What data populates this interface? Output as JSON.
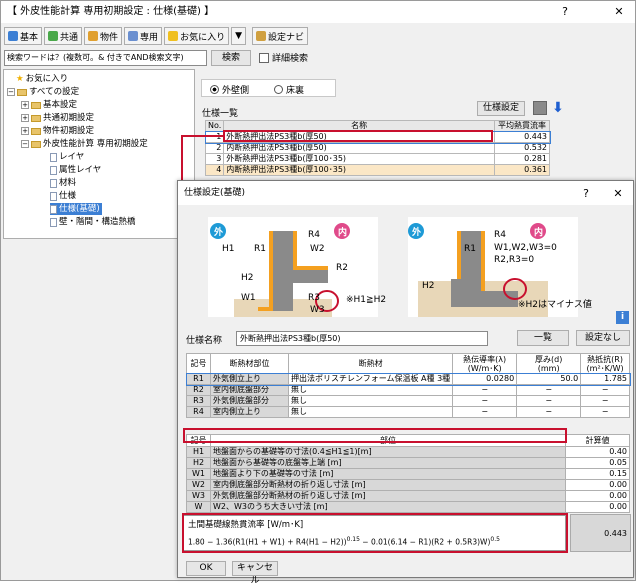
{
  "window": {
    "title": "【 外皮性能計算 専用初期設定 : 仕様(基礎) 】",
    "help": "?",
    "close": "✕"
  },
  "toolbar": {
    "basic": "基本",
    "common": "共通",
    "property": "物件",
    "dedicated": "専用",
    "favorites": "お気に入り",
    "dropdown": "▼",
    "navi": "設定ナビ"
  },
  "search": {
    "value": "検索ワードは？(複数可。& 付きでAND検索文字)",
    "button": "検索",
    "detail": "詳細検索"
  },
  "tree": [
    {
      "label": "お気に入り",
      "level": 0,
      "icon": "star"
    },
    {
      "label": "すべての設定",
      "level": 0,
      "expander": "−"
    },
    {
      "label": "基本設定",
      "level": 1,
      "expander": "+"
    },
    {
      "label": "共通初期設定",
      "level": 1,
      "expander": "+"
    },
    {
      "label": "物件初期設定",
      "level": 1,
      "expander": "+"
    },
    {
      "label": "外皮性能計算 専用初期設定",
      "level": 1,
      "expander": "−"
    },
    {
      "label": "レイヤ",
      "level": 2
    },
    {
      "label": "属性レイヤ",
      "level": 2
    },
    {
      "label": "材料",
      "level": 2
    },
    {
      "label": "仕様",
      "level": 2
    },
    {
      "label": "仕様(基礎)",
      "level": 2,
      "selected": true
    },
    {
      "label": "壁・階間・構造熱橋",
      "level": 2
    }
  ],
  "side": {
    "radio_outer": "外壁側",
    "radio_floor": "床裏",
    "list_title": "仕様一覧",
    "spec_button": "仕様設定"
  },
  "spec_list": {
    "headers": [
      "No.",
      "名称",
      "平均熱貫流率"
    ],
    "rows": [
      [
        "1",
        "外断熱押出法PS3種b(厚50)",
        "0.443"
      ],
      [
        "2",
        "内断熱押出法PS3種b(厚50)",
        "0.532"
      ],
      [
        "3",
        "外断熱押出法PS3種b(厚100･35)",
        "0.281"
      ],
      [
        "4",
        "内断熱押出法PS3種b(厚100･35)",
        "0.361"
      ]
    ]
  },
  "dialog": {
    "title": "仕様設定(基礎)",
    "help": "?",
    "close": "✕",
    "outer": "外",
    "inner": "内",
    "d1": {
      "H1": "H1",
      "R1": "R1",
      "R4": "R4",
      "W2": "W2",
      "R2": "R2",
      "H2": "H2",
      "W1": "W1",
      "R3": "R3",
      "W3": "W3",
      "note": "※H1≧H2"
    },
    "d2": {
      "R1": "R1",
      "R4": "R4",
      "W": "W1,W2,W3=0",
      "R": "R2,R3=0",
      "H2": "H2",
      "note": "※H2はマイナス値"
    },
    "name_label": "仕様名称",
    "name_value": "外断熱押出法PS3種b(厚50)",
    "list_button": "一覧",
    "none_button": "設定なし",
    "t2_headers": [
      "記号",
      "断熱材部位",
      "断熱材",
      "熱伝導率(λ)\n(W/m･K)",
      "厚み(d)\n(mm)",
      "熱抵抗(R)\n(m²･K/W)"
    ],
    "t2_rows": [
      [
        "R1",
        "外気側立上り",
        "押出法ポリスチレンフォーム保温板 A種 3種",
        "0.0280",
        "50.0",
        "1.785"
      ],
      [
        "R2",
        "室内側底盤部分",
        "無し",
        "−",
        "−",
        "−"
      ],
      [
        "R3",
        "外気側底盤部分",
        "無し",
        "−",
        "−",
        "−"
      ],
      [
        "R4",
        "室内側立上り",
        "無し",
        "−",
        "−",
        "−"
      ]
    ],
    "t3_headers": [
      "記号",
      "部位",
      "計算値"
    ],
    "t3_rows": [
      [
        "H1",
        "地盤面からの基礎等の寸法(0.4≦H1≦1)[m]",
        "0.40"
      ],
      [
        "H2",
        "地盤面から基礎等の底盤等上端 [m]",
        "0.05"
      ],
      [
        "W1",
        "地盤面より下の基礎等の寸法 [m]",
        "0.15"
      ],
      [
        "W2",
        "室内側底盤部分断熱材の折り返し寸法 [m]",
        "0.00"
      ],
      [
        "W3",
        "外気側底盤部分断熱材の折り返し寸法 [m]",
        "0.00"
      ],
      [
        "W",
        "W2、W3のうち大きい寸法 [m]",
        "0.00"
      ]
    ],
    "formula_title": "土間基礎線熱貫流率 [W/m･K]",
    "formula": "1.80 − 1.36(R1(H1 + W1) + R4(H1 − H2))",
    "exp1": "0.15",
    "formula2": " − 0.01(6.14 − R1)(R2 + 0.5R3)W)",
    "exp2": "0.5",
    "result": "0.443",
    "ok": "OK",
    "cancel": "キャンセル"
  },
  "colors": {
    "accent": "#c8102e",
    "insulation": "#f4a020",
    "concrete": "#888888",
    "soil": "#e8d7b8",
    "select": "#3c7fd4"
  }
}
